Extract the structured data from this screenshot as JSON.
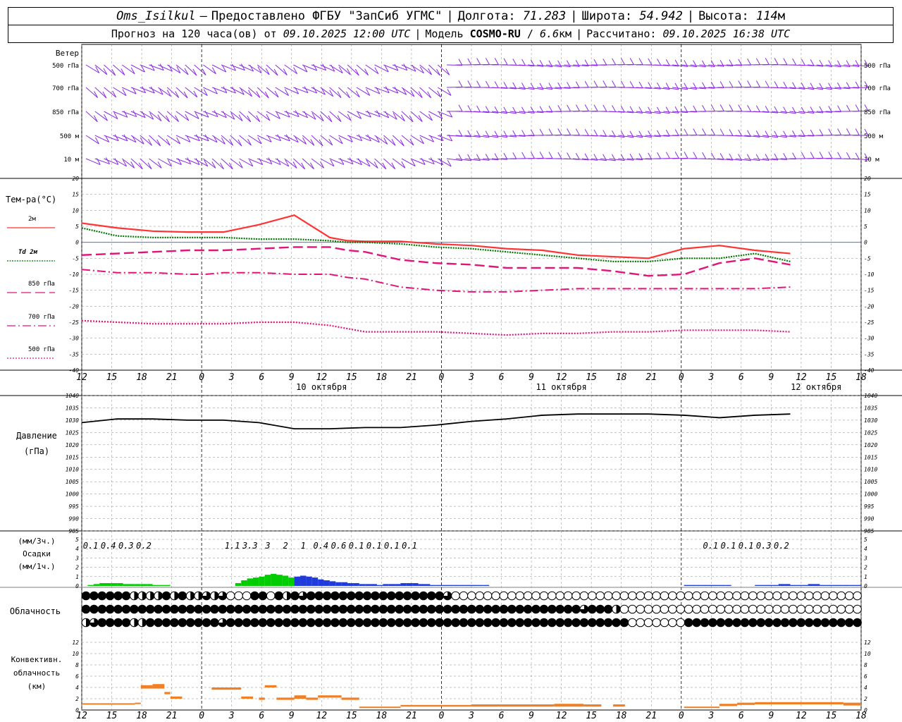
{
  "header": {
    "station": "Oms_Isilkul",
    "provider": "Предоставлено ФГБУ \"ЗапСиб УГМС\"",
    "lon_label": "Долгота:",
    "lon_value": "71.283",
    "lat_label": "Широта:",
    "lat_value": "54.942",
    "alt_label": "Высота:",
    "alt_value": "114",
    "alt_unit": "м",
    "forecast_label": "Прогноз на 120 часа(ов) от",
    "forecast_time": "09.10.2025 12:00 UTC",
    "model_label": "Модель",
    "model_name": "COSMO-RU",
    "model_res": "6.6",
    "model_res_unit": "км",
    "calc_label": "Рассчитано:",
    "calc_time": "09.10.2025 16:38 UTC"
  },
  "colors": {
    "t2m": "#ff3333",
    "td2m": "#007700",
    "t850": "#e0147a",
    "t700": "#e0147a",
    "t500": "#e0147a",
    "wind": "#8a2be2",
    "rain": "#00cc00",
    "snow": "#1f3bdc",
    "conv": "#f07f26",
    "grid": "#888888"
  },
  "chart_data": [
    {
      "id": "wind",
      "type": "wind-barbs",
      "title": "Ветер",
      "levels": [
        "500 гПа",
        "700 гПа",
        "850 гПа",
        "500 м",
        "10 м"
      ]
    },
    {
      "id": "temperature",
      "type": "line",
      "ylabel": "Тем-ра(°С)",
      "ylim": [
        -40,
        20
      ],
      "yticks": [
        20,
        15,
        10,
        5,
        0,
        -5,
        -10,
        -15,
        -20,
        -25,
        -30,
        -35,
        -40
      ],
      "x_hours": [
        0,
        6,
        12,
        18,
        21,
        24,
        30,
        36,
        42,
        45,
        48,
        54,
        60,
        66,
        72,
        78,
        84,
        90,
        96,
        102,
        108,
        114,
        120
      ],
      "series": [
        {
          "name": "2м",
          "values": [
            6,
            4.5,
            3.5,
            3.2,
            3.2,
            3.2,
            5.5,
            8.5,
            1.5,
            0.5,
            0.3,
            0.3,
            -0.5,
            -1,
            -2,
            -2.5,
            -4,
            -4.5,
            -5,
            -2,
            -1,
            -2.5,
            -3.5
          ]
        },
        {
          "name": "Td 2м",
          "values": [
            4.5,
            2,
            1.5,
            1.5,
            1.5,
            1.5,
            1,
            1,
            0.5,
            0,
            0,
            -0.5,
            -1.5,
            -2,
            -3,
            -4,
            -5,
            -6,
            -6,
            -5,
            -5,
            -3.5,
            -6
          ]
        },
        {
          "name": "850 гПа",
          "values": [
            -4,
            -3.5,
            -3,
            -2.5,
            -2.5,
            -2.5,
            -2,
            -1.5,
            -1.5,
            -2.5,
            -3,
            -5.5,
            -6.5,
            -7,
            -8,
            -8,
            -8,
            -9,
            -10.5,
            -10,
            -6.5,
            -5,
            -7
          ]
        },
        {
          "name": "700 гПа",
          "values": [
            -8.5,
            -9.5,
            -9.5,
            -10,
            -10,
            -9.5,
            -9.5,
            -10,
            -10,
            -11,
            -11.5,
            -14,
            -15,
            -15.5,
            -15.5,
            -15,
            -14.5,
            -14.5,
            -14.5,
            -14.5,
            -14.5,
            -14.5,
            -14
          ]
        },
        {
          "name": "500 гПа",
          "values": [
            -24.5,
            -25,
            -25.5,
            -25.5,
            -25.5,
            -25.5,
            -25,
            -25,
            -26,
            -27,
            -28,
            -28,
            -28,
            -28.5,
            -29,
            -28.5,
            -28.5,
            -28,
            -28,
            -27.5,
            -27.5,
            -27.5,
            -28
          ]
        }
      ]
    },
    {
      "id": "pressure",
      "type": "line",
      "ylabel": "Давление",
      "ylabel2": "(гПа)",
      "ylim": [
        985,
        1040
      ],
      "yticks": [
        1040,
        1035,
        1030,
        1025,
        1020,
        1015,
        1010,
        1005,
        1000,
        995,
        990,
        985
      ],
      "x_hours": [
        0,
        6,
        12,
        18,
        24,
        30,
        36,
        42,
        48,
        54,
        60,
        66,
        72,
        78,
        84,
        90,
        96,
        102,
        108,
        114,
        120
      ],
      "values": [
        1029,
        1030.5,
        1030.5,
        1030,
        1030,
        1029,
        1026.5,
        1026.5,
        1027,
        1027,
        1028,
        1029.5,
        1030.5,
        1032,
        1032.5,
        1032.5,
        1032.5,
        1032,
        1031,
        1032,
        1032.5
      ]
    },
    {
      "id": "precipitation",
      "type": "bar",
      "ylabel1": "(мм/3ч.)",
      "ylabel2": "Осадки",
      "ylabel3": "(мм/1ч.)",
      "ylim": [
        0,
        5
      ],
      "yticks": [
        5,
        4,
        3,
        2,
        1,
        0
      ],
      "totals_3h": [
        {
          "h": 3,
          "v": "0.1"
        },
        {
          "h": 6,
          "v": "0.4"
        },
        {
          "h": 9,
          "v": "0.3"
        },
        {
          "h": 12,
          "v": "0.2"
        },
        {
          "h": 27,
          "v": "1.1"
        },
        {
          "h": 30,
          "v": "3.3"
        },
        {
          "h": 33,
          "v": "3"
        },
        {
          "h": 36,
          "v": "2"
        },
        {
          "h": 39,
          "v": "1"
        },
        {
          "h": 42,
          "v": "0.4"
        },
        {
          "h": 45,
          "v": "0.6"
        },
        {
          "h": 48,
          "v": "0.1"
        },
        {
          "h": 51,
          "v": "0.1"
        },
        {
          "h": 54,
          "v": "0.1"
        },
        {
          "h": 57,
          "v": "0.1"
        },
        {
          "h": 108,
          "v": "0.1"
        },
        {
          "h": 111,
          "v": "0.1"
        },
        {
          "h": 114,
          "v": "0.1"
        },
        {
          "h": 117,
          "v": "0.3"
        },
        {
          "h": 120,
          "v": "0.2"
        }
      ],
      "rain_hourly": [
        [
          2,
          0.1
        ],
        [
          3,
          0.2
        ],
        [
          4,
          0.3
        ],
        [
          5,
          0.3
        ],
        [
          6,
          0.3
        ],
        [
          7,
          0.3
        ],
        [
          8,
          0.2
        ],
        [
          9,
          0.2
        ],
        [
          10,
          0.2
        ],
        [
          11,
          0.2
        ],
        [
          12,
          0.2
        ],
        [
          13,
          0.1
        ],
        [
          14,
          0.1
        ],
        [
          15,
          0.1
        ],
        [
          27,
          0.3
        ],
        [
          28,
          0.6
        ],
        [
          29,
          0.8
        ],
        [
          30,
          0.9
        ],
        [
          31,
          1.0
        ],
        [
          32,
          1.2
        ],
        [
          33,
          1.3
        ],
        [
          34,
          1.2
        ],
        [
          35,
          1.1
        ],
        [
          36,
          0.9
        ]
      ],
      "snow_hourly": [
        [
          37,
          1.0
        ],
        [
          38,
          1.1
        ],
        [
          39,
          1.0
        ],
        [
          40,
          0.9
        ],
        [
          41,
          0.7
        ],
        [
          42,
          0.6
        ],
        [
          43,
          0.5
        ],
        [
          44,
          0.4
        ],
        [
          45,
          0.4
        ],
        [
          46,
          0.3
        ],
        [
          47,
          0.3
        ],
        [
          48,
          0.2
        ],
        [
          49,
          0.2
        ],
        [
          50,
          0.2
        ],
        [
          51,
          0.1
        ],
        [
          52,
          0.2
        ],
        [
          53,
          0.2
        ],
        [
          54,
          0.2
        ],
        [
          55,
          0.3
        ],
        [
          56,
          0.3
        ],
        [
          57,
          0.3
        ],
        [
          58,
          0.2
        ],
        [
          59,
          0.2
        ],
        [
          60,
          0.1
        ],
        [
          61,
          0.1
        ],
        [
          62,
          0.1
        ],
        [
          63,
          0.1
        ],
        [
          64,
          0.1
        ],
        [
          65,
          0.1
        ],
        [
          66,
          0.1
        ],
        [
          67,
          0.1
        ],
        [
          68,
          0.1
        ],
        [
          69,
          0.1
        ],
        [
          103,
          0.1
        ],
        [
          104,
          0.1
        ],
        [
          105,
          0.1
        ],
        [
          106,
          0.1
        ],
        [
          107,
          0.1
        ],
        [
          108,
          0.1
        ],
        [
          109,
          0.1
        ],
        [
          110,
          0.1
        ],
        [
          115,
          0.1
        ],
        [
          116,
          0.1
        ],
        [
          117,
          0.1
        ],
        [
          118,
          0.1
        ],
        [
          119,
          0.2
        ],
        [
          120,
          0.2
        ],
        [
          121,
          0.1
        ],
        [
          122,
          0.1
        ],
        [
          123,
          0.1
        ],
        [
          124,
          0.2
        ],
        [
          125,
          0.2
        ],
        [
          126,
          0.1
        ],
        [
          127,
          0.1
        ],
        [
          128,
          0.1
        ],
        [
          129,
          0.1
        ],
        [
          130,
          0.1
        ],
        [
          131,
          0.1
        ],
        [
          132,
          0.1
        ]
      ]
    },
    {
      "id": "cloudiness",
      "type": "cloud-symbols",
      "ylabel": "Облачность",
      "rows": [
        "FFFFFFHHHHFHFHHTHTEEEFFEFHFTFFFFFFFFFFFFFFFFFTEEEEEEEEEEEEEEEEEEEEEEEEEEEEEEEEEEEEEEEEEEEEEEEEEEE",
        "FFFFFFFFFFFFFFFFFFFFFFFFFFFFFFFFFFFFFFFFFFFFFFFFFFFFFFFFFFFFFFTFFFHEEEEEEEEEEEEEEEEEEEEEEEEEEEEEE",
        "HTFFFFHHFFFFFFFFFTFFFFFFFFFFFFFFFFFFFFFFFFFFFFFFFFFFFFFFFFFFFFFFFFFFEEEEEEEFFFFFFFFFFFFFFFFFFFFFF"
      ]
    },
    {
      "id": "convective",
      "type": "bar",
      "ylabel1": "Конвективн.",
      "ylabel2": "облачность",
      "ylabel3": "(км)",
      "ylim": [
        0,
        14
      ],
      "yticks": [
        12,
        10,
        8,
        6,
        4,
        2,
        0
      ],
      "segments": [
        {
          "h0": 0,
          "h1": 3,
          "base": 1.0,
          "top": 1.2
        },
        {
          "h0": 3,
          "h1": 6,
          "base": 1.0,
          "top": 1.2
        },
        {
          "h0": 6,
          "h1": 9,
          "base": 1.0,
          "top": 1.2
        },
        {
          "h0": 9,
          "h1": 10,
          "base": 1.1,
          "top": 1.3
        },
        {
          "h0": 10,
          "h1": 12,
          "base": 3.8,
          "top": 4.4
        },
        {
          "h0": 12,
          "h1": 14,
          "base": 3.8,
          "top": 4.6
        },
        {
          "h0": 14,
          "h1": 15,
          "base": 2.8,
          "top": 3.2
        },
        {
          "h0": 15,
          "h1": 17,
          "base": 2.0,
          "top": 2.4
        },
        {
          "h0": 22,
          "h1": 27,
          "base": 3.6,
          "top": 4.0
        },
        {
          "h0": 27,
          "h1": 29,
          "base": 2.0,
          "top": 2.4
        },
        {
          "h0": 30,
          "h1": 31,
          "base": 1.8,
          "top": 2.2
        },
        {
          "h0": 31,
          "h1": 33,
          "base": 4.0,
          "top": 4.4
        },
        {
          "h0": 33,
          "h1": 36,
          "base": 1.8,
          "top": 2.2
        },
        {
          "h0": 36,
          "h1": 38,
          "base": 2.0,
          "top": 2.6
        },
        {
          "h0": 38,
          "h1": 40,
          "base": 1.8,
          "top": 2.2
        },
        {
          "h0": 40,
          "h1": 44,
          "base": 2.2,
          "top": 2.6
        },
        {
          "h0": 44,
          "h1": 47,
          "base": 1.8,
          "top": 2.2
        },
        {
          "h0": 47,
          "h1": 54,
          "base": 0.4,
          "top": 0.6
        },
        {
          "h0": 54,
          "h1": 66,
          "base": 0.6,
          "top": 0.9
        },
        {
          "h0": 66,
          "h1": 80,
          "base": 0.6,
          "top": 1.0
        },
        {
          "h0": 80,
          "h1": 85,
          "base": 0.6,
          "top": 1.1
        },
        {
          "h0": 85,
          "h1": 88,
          "base": 0.6,
          "top": 1.0
        },
        {
          "h0": 90,
          "h1": 92,
          "base": 0.6,
          "top": 1.0
        },
        {
          "h0": 102,
          "h1": 108,
          "base": 0.4,
          "top": 0.6
        },
        {
          "h0": 108,
          "h1": 111,
          "base": 0.7,
          "top": 1.1
        },
        {
          "h0": 111,
          "h1": 114,
          "base": 0.9,
          "top": 1.3
        },
        {
          "h0": 114,
          "h1": 129,
          "base": 1.0,
          "top": 1.4
        },
        {
          "h0": 129,
          "h1": 132,
          "base": 0.8,
          "top": 1.3
        }
      ]
    }
  ],
  "time_axis": {
    "start_hour": 12,
    "tick_labels": [
      "12",
      "15",
      "18",
      "21",
      "0",
      "3",
      "6",
      "9",
      "12",
      "15",
      "18",
      "21",
      "0",
      "3",
      "6",
      "9",
      "12",
      "15",
      "18",
      "21",
      "0",
      "3",
      "6",
      "9",
      "12",
      "15",
      "18"
    ],
    "midnight_positions": [
      4,
      12,
      20
    ],
    "dates": [
      {
        "pos": 8,
        "label": "10 октября"
      },
      {
        "pos": 16,
        "label": "11 октября"
      },
      {
        "pos": 24.5,
        "label": "12 октября"
      }
    ]
  }
}
